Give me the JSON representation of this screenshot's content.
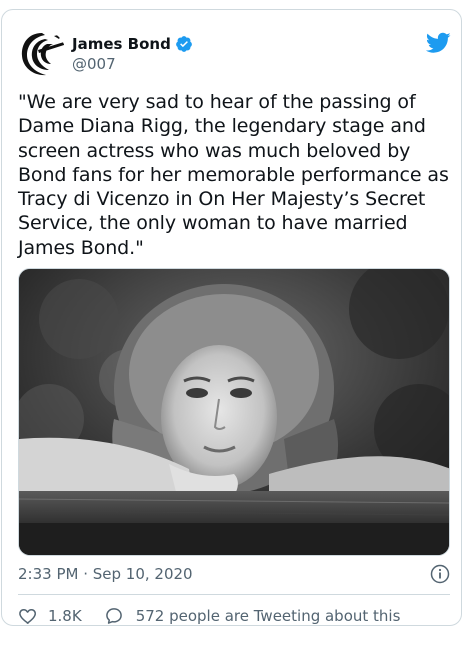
{
  "author": {
    "name": "James Bond",
    "handle": "@007"
  },
  "tweet": {
    "text": "\"We are very sad to hear of the passing of Dame Diana Rigg, the legendary stage and screen actress who was much beloved by Bond fans for her memorable performance as Tracy di Vicenzo in On Her Majesty’s Secret Service, the only woman to have married James Bond.\"",
    "timestamp": "2:33 PM · Sep 10, 2020"
  },
  "stats": {
    "likes": "1.8K",
    "conversation": "572 people are Tweeting about this"
  },
  "icons": {
    "brand": "twitter-bird-icon",
    "verified": "verified-badge-icon",
    "info": "info-icon",
    "like": "heart-icon",
    "reply": "speech-bubble-icon"
  },
  "colors": {
    "brand_blue": "#1d9bf0",
    "text_primary": "#0f1419",
    "text_secondary": "#536471",
    "border": "#cfd9de"
  }
}
